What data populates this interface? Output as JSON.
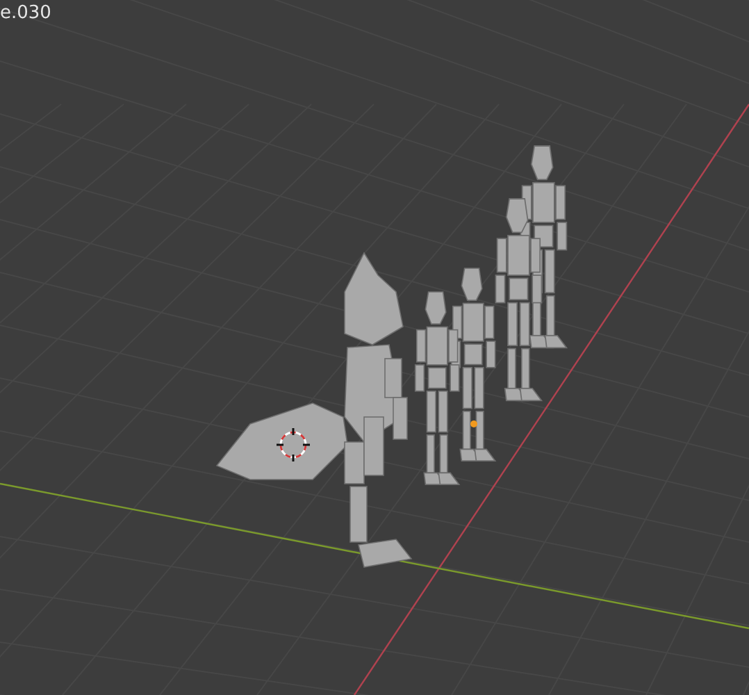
{
  "viewport": {
    "object_label": "e.030"
  }
}
